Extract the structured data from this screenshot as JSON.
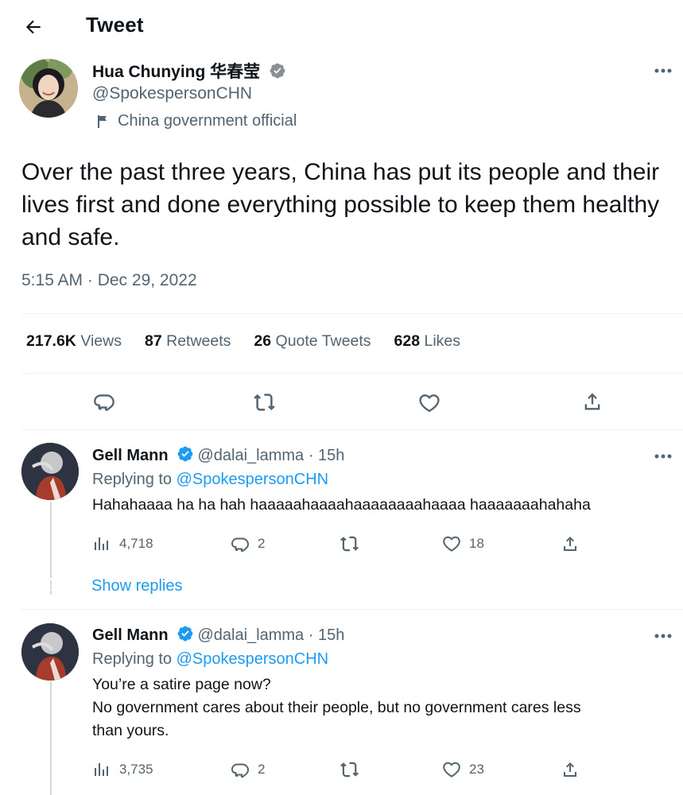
{
  "header": {
    "title": "Tweet"
  },
  "tweet": {
    "author_name": "Hua Chunying 华春莹",
    "author_handle": "@SpokespersonCHN",
    "author_label": "China government official",
    "text": "Over the past three years, China has put its people and their lives first and done everything possible to keep them healthy and safe.",
    "timestamp": "5:15 AM · Dec 29, 2022",
    "stats": {
      "views_count": "217.6K",
      "views_label": "Views",
      "retweets_count": "87",
      "retweets_label": "Retweets",
      "quotes_count": "26",
      "quotes_label": "Quote Tweets",
      "likes_count": "628",
      "likes_label": "Likes"
    }
  },
  "replies": [
    {
      "name": "Gell Mann",
      "handle_time": "@dalai_lamma · 15h",
      "replying_label": "Replying to ",
      "replying_handle": "@SpokespersonCHN",
      "text": "Hahahaaaa ha ha hah haaaaahaaaahaaaaaaaahaaaa haaaaaaahahaha",
      "views": "4,718",
      "replies": "2",
      "likes": "18",
      "show_replies": "Show replies"
    },
    {
      "name": "Gell Mann",
      "handle_time": "@dalai_lamma · 15h",
      "replying_label": "Replying to ",
      "replying_handle": "@SpokespersonCHN",
      "text_line_1": "You’re a satire page now?",
      "text_line_2": "No government cares about their people, but no government cares less",
      "text_line_3": "than yours.",
      "views": "3,735",
      "replies": "2",
      "likes": "23"
    }
  ],
  "colors": {
    "accent": "#1d9bf0",
    "text": "#0f1419",
    "muted": "#536471",
    "divider": "#eff3f4"
  },
  "icons": [
    "back-arrow-icon",
    "more-icon",
    "verified-badge-icon",
    "flag-icon",
    "reply-icon",
    "retweet-icon",
    "like-icon",
    "share-icon",
    "views-icon"
  ]
}
